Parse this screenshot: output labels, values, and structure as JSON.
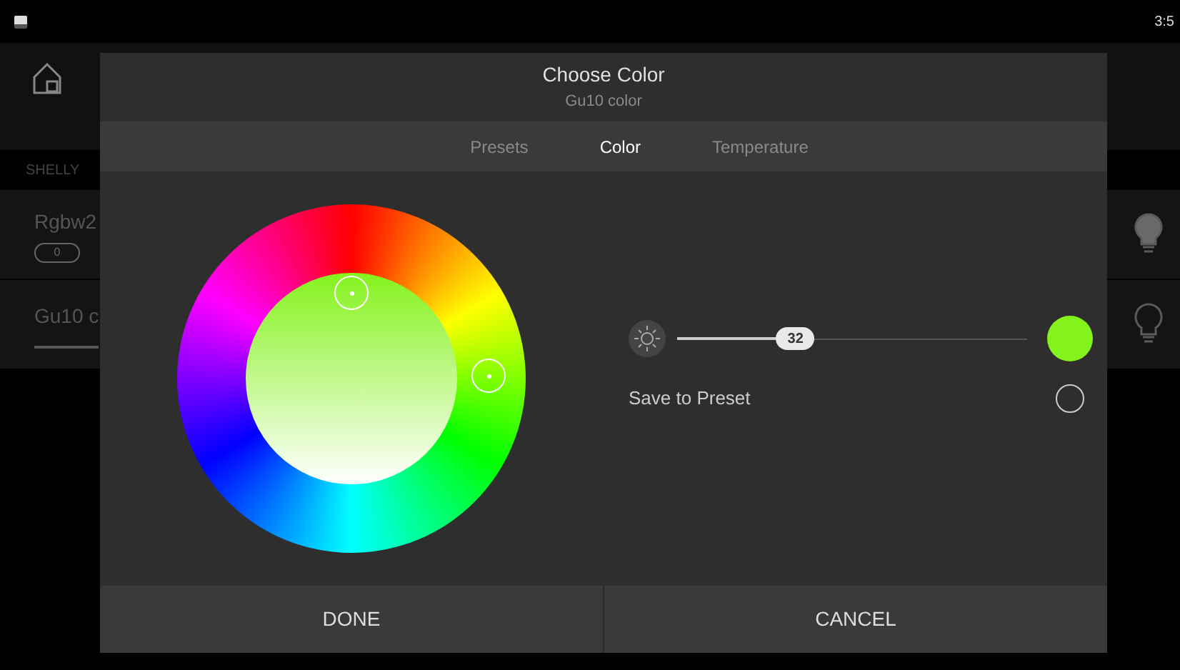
{
  "status_bar": {
    "time": "3:5"
  },
  "background": {
    "section": "SHELLY",
    "devices": [
      {
        "name": "Rgbw2",
        "kind": "toggle",
        "value": "0",
        "on": true
      },
      {
        "name": "Gu10 c",
        "kind": "slider",
        "on": false
      }
    ]
  },
  "dialog": {
    "title": "Choose Color",
    "subtitle": "Gu10 color",
    "tabs": [
      {
        "label": "Presets",
        "selected": false
      },
      {
        "label": "Color",
        "selected": true
      },
      {
        "label": "Temperature",
        "selected": false
      }
    ],
    "swatch": {
      "color": "#84f21c"
    },
    "brightness": {
      "level": 0.34,
      "reading": "32"
    },
    "save_to_preset": {
      "label": "Save to Preset",
      "checked": false
    },
    "buttons": [
      "DONE",
      "CANCEL"
    ]
  }
}
